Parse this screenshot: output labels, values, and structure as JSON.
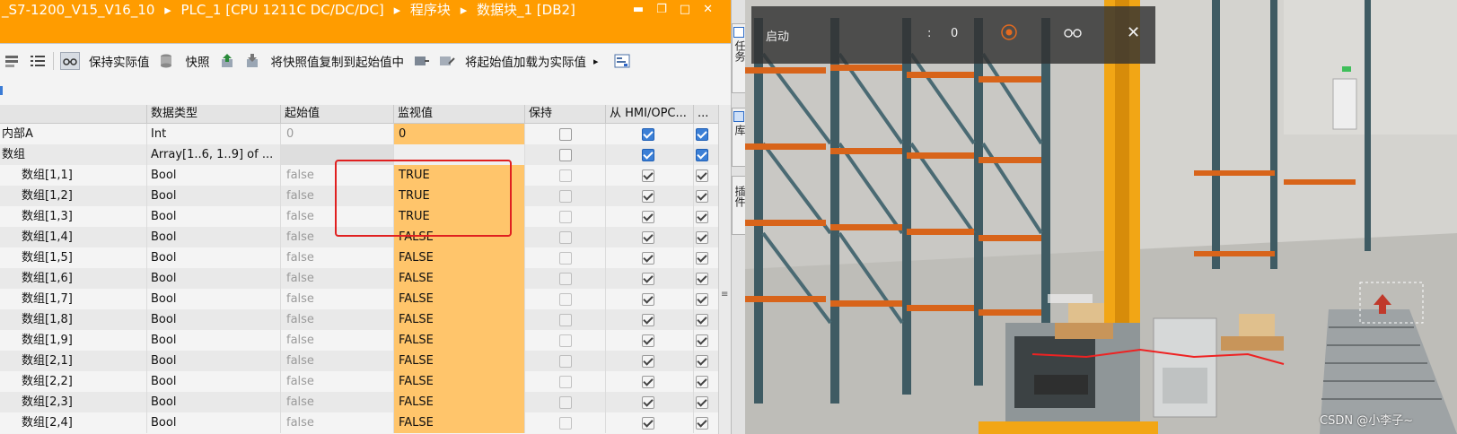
{
  "window": {
    "breadcrumb": [
      "_S7-1200_V15_V16_10",
      "PLC_1 [CPU 1211C DC/DC/DC]",
      "程序块",
      "数据块_1 [DB2]"
    ],
    "separator": "▸"
  },
  "toolbar": {
    "keep_actual": "保持实际值",
    "snapshot": "快照",
    "copy_snapshot": "将快照值复制到起始值中",
    "load_start": "将起始值加载为实际值"
  },
  "table": {
    "headers": [
      "数据类型",
      "起始值",
      "监视值",
      "保持",
      "从 HMI/OPC...",
      "..."
    ],
    "rows": [
      {
        "name": "内部A",
        "type": "Int",
        "start": "0",
        "monitor": "0",
        "keep_checked": false,
        "hmi_checked": true,
        "indent": false
      },
      {
        "name": "数组",
        "type": "Array[1..6, 1..9] of ...",
        "start": "",
        "monitor": "",
        "keep_checked": false,
        "hmi_checked": true,
        "indent": false
      },
      {
        "name": "数组[1,1]",
        "type": "Bool",
        "start": "false",
        "monitor": "TRUE",
        "keep_checked": false,
        "hmi_checked": true,
        "indent": true
      },
      {
        "name": "数组[1,2]",
        "type": "Bool",
        "start": "false",
        "monitor": "TRUE",
        "keep_checked": false,
        "hmi_checked": true,
        "indent": true
      },
      {
        "name": "数组[1,3]",
        "type": "Bool",
        "start": "false",
        "monitor": "TRUE",
        "keep_checked": false,
        "hmi_checked": true,
        "indent": true
      },
      {
        "name": "数组[1,4]",
        "type": "Bool",
        "start": "false",
        "monitor": "FALSE",
        "keep_checked": false,
        "hmi_checked": true,
        "indent": true
      },
      {
        "name": "数组[1,5]",
        "type": "Bool",
        "start": "false",
        "monitor": "FALSE",
        "keep_checked": false,
        "hmi_checked": true,
        "indent": true
      },
      {
        "name": "数组[1,6]",
        "type": "Bool",
        "start": "false",
        "monitor": "FALSE",
        "keep_checked": false,
        "hmi_checked": true,
        "indent": true
      },
      {
        "name": "数组[1,7]",
        "type": "Bool",
        "start": "false",
        "monitor": "FALSE",
        "keep_checked": false,
        "hmi_checked": true,
        "indent": true
      },
      {
        "name": "数组[1,8]",
        "type": "Bool",
        "start": "false",
        "monitor": "FALSE",
        "keep_checked": false,
        "hmi_checked": true,
        "indent": true
      },
      {
        "name": "数组[1,9]",
        "type": "Bool",
        "start": "false",
        "monitor": "FALSE",
        "keep_checked": false,
        "hmi_checked": true,
        "indent": true
      },
      {
        "name": "数组[2,1]",
        "type": "Bool",
        "start": "false",
        "monitor": "FALSE",
        "keep_checked": false,
        "hmi_checked": true,
        "indent": true
      },
      {
        "name": "数组[2,2]",
        "type": "Bool",
        "start": "false",
        "monitor": "FALSE",
        "keep_checked": false,
        "hmi_checked": true,
        "indent": true
      },
      {
        "name": "数组[2,3]",
        "type": "Bool",
        "start": "false",
        "monitor": "FALSE",
        "keep_checked": false,
        "hmi_checked": true,
        "indent": true
      },
      {
        "name": "数组[2,4]",
        "type": "Bool",
        "start": "false",
        "monitor": "FALSE",
        "keep_checked": false,
        "hmi_checked": true,
        "indent": true
      }
    ]
  },
  "side_tabs": [
    "任务",
    "库",
    "插件"
  ],
  "hud": {
    "label": "启动",
    "colon": ":",
    "value": "0"
  },
  "watermark": "CSDN @小李子~",
  "colors": {
    "title_orange": "#ff9c00",
    "monitor_cell": "#ffc56b",
    "highlight_red": "#e02020",
    "checkbox_blue": "#3b7fd6"
  }
}
